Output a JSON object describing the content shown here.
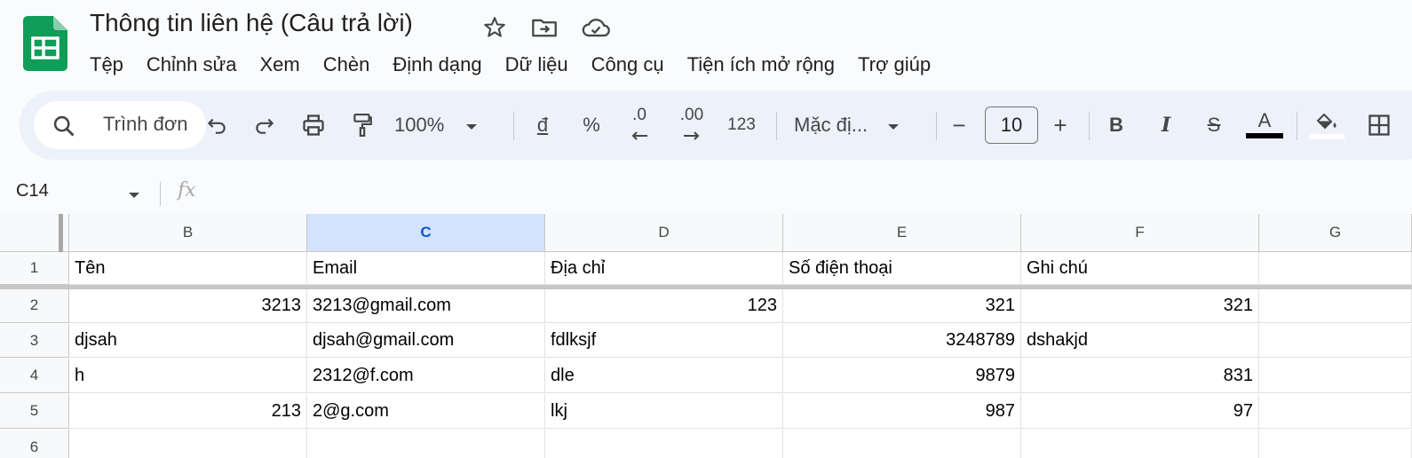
{
  "title": "Thông tin liên hệ (Câu trả lời)",
  "menu": [
    "Tệp",
    "Chỉnh sửa",
    "Xem",
    "Chèn",
    "Định dạng",
    "Dữ liệu",
    "Công cụ",
    "Tiện ích mở rộng",
    "Trợ giúp"
  ],
  "toolbar": {
    "search_label": "Trình đơn",
    "zoom": "100%",
    "currency": "đ",
    "percent": "%",
    "decrease_decimal": ".0",
    "increase_decimal": ".00",
    "number_format": "123",
    "font": "Mặc đị...",
    "font_size": "10",
    "minus": "−",
    "plus": "+",
    "bold": "B",
    "italic": "I",
    "strikethrough": "S",
    "text_color_label": "A",
    "text_color": "#000000"
  },
  "formula_bar": {
    "cell_ref": "C14",
    "fx": "fx"
  },
  "sheet": {
    "columns": [
      "B",
      "C",
      "D",
      "E",
      "F",
      "G"
    ],
    "selected_column": "C",
    "rows": [
      {
        "num": "1",
        "cells": [
          {
            "v": "Tên"
          },
          {
            "v": "Email"
          },
          {
            "v": "Địa chỉ"
          },
          {
            "v": "Số điện thoại"
          },
          {
            "v": "Ghi chú"
          },
          {
            "v": ""
          }
        ]
      },
      {
        "num": "2",
        "cells": [
          {
            "v": "3213",
            "n": true
          },
          {
            "v": "3213@gmail.com"
          },
          {
            "v": "123",
            "n": true
          },
          {
            "v": "321",
            "n": true
          },
          {
            "v": "321",
            "n": true
          },
          {
            "v": ""
          }
        ]
      },
      {
        "num": "3",
        "cells": [
          {
            "v": "djsah"
          },
          {
            "v": "djsah@gmail.com"
          },
          {
            "v": "fdlksjf"
          },
          {
            "v": "3248789",
            "n": true
          },
          {
            "v": "dshakjd"
          },
          {
            "v": ""
          }
        ]
      },
      {
        "num": "4",
        "cells": [
          {
            "v": "h"
          },
          {
            "v": "2312@f.com"
          },
          {
            "v": "dle"
          },
          {
            "v": "9879",
            "n": true
          },
          {
            "v": "831",
            "n": true
          },
          {
            "v": ""
          }
        ]
      },
      {
        "num": "5",
        "cells": [
          {
            "v": "213",
            "n": true
          },
          {
            "v": "2@g.com"
          },
          {
            "v": "lkj"
          },
          {
            "v": "987",
            "n": true
          },
          {
            "v": "97",
            "n": true
          },
          {
            "v": ""
          }
        ]
      },
      {
        "num": "6",
        "cells": [
          {
            "v": ""
          },
          {
            "v": ""
          },
          {
            "v": ""
          },
          {
            "v": ""
          },
          {
            "v": ""
          },
          {
            "v": ""
          }
        ]
      }
    ]
  },
  "colors": {
    "brand": "#0f9d58",
    "accent": "#0b57d0",
    "selected_header": "#d3e3fd",
    "toolbar_bg": "#edf2fa"
  }
}
